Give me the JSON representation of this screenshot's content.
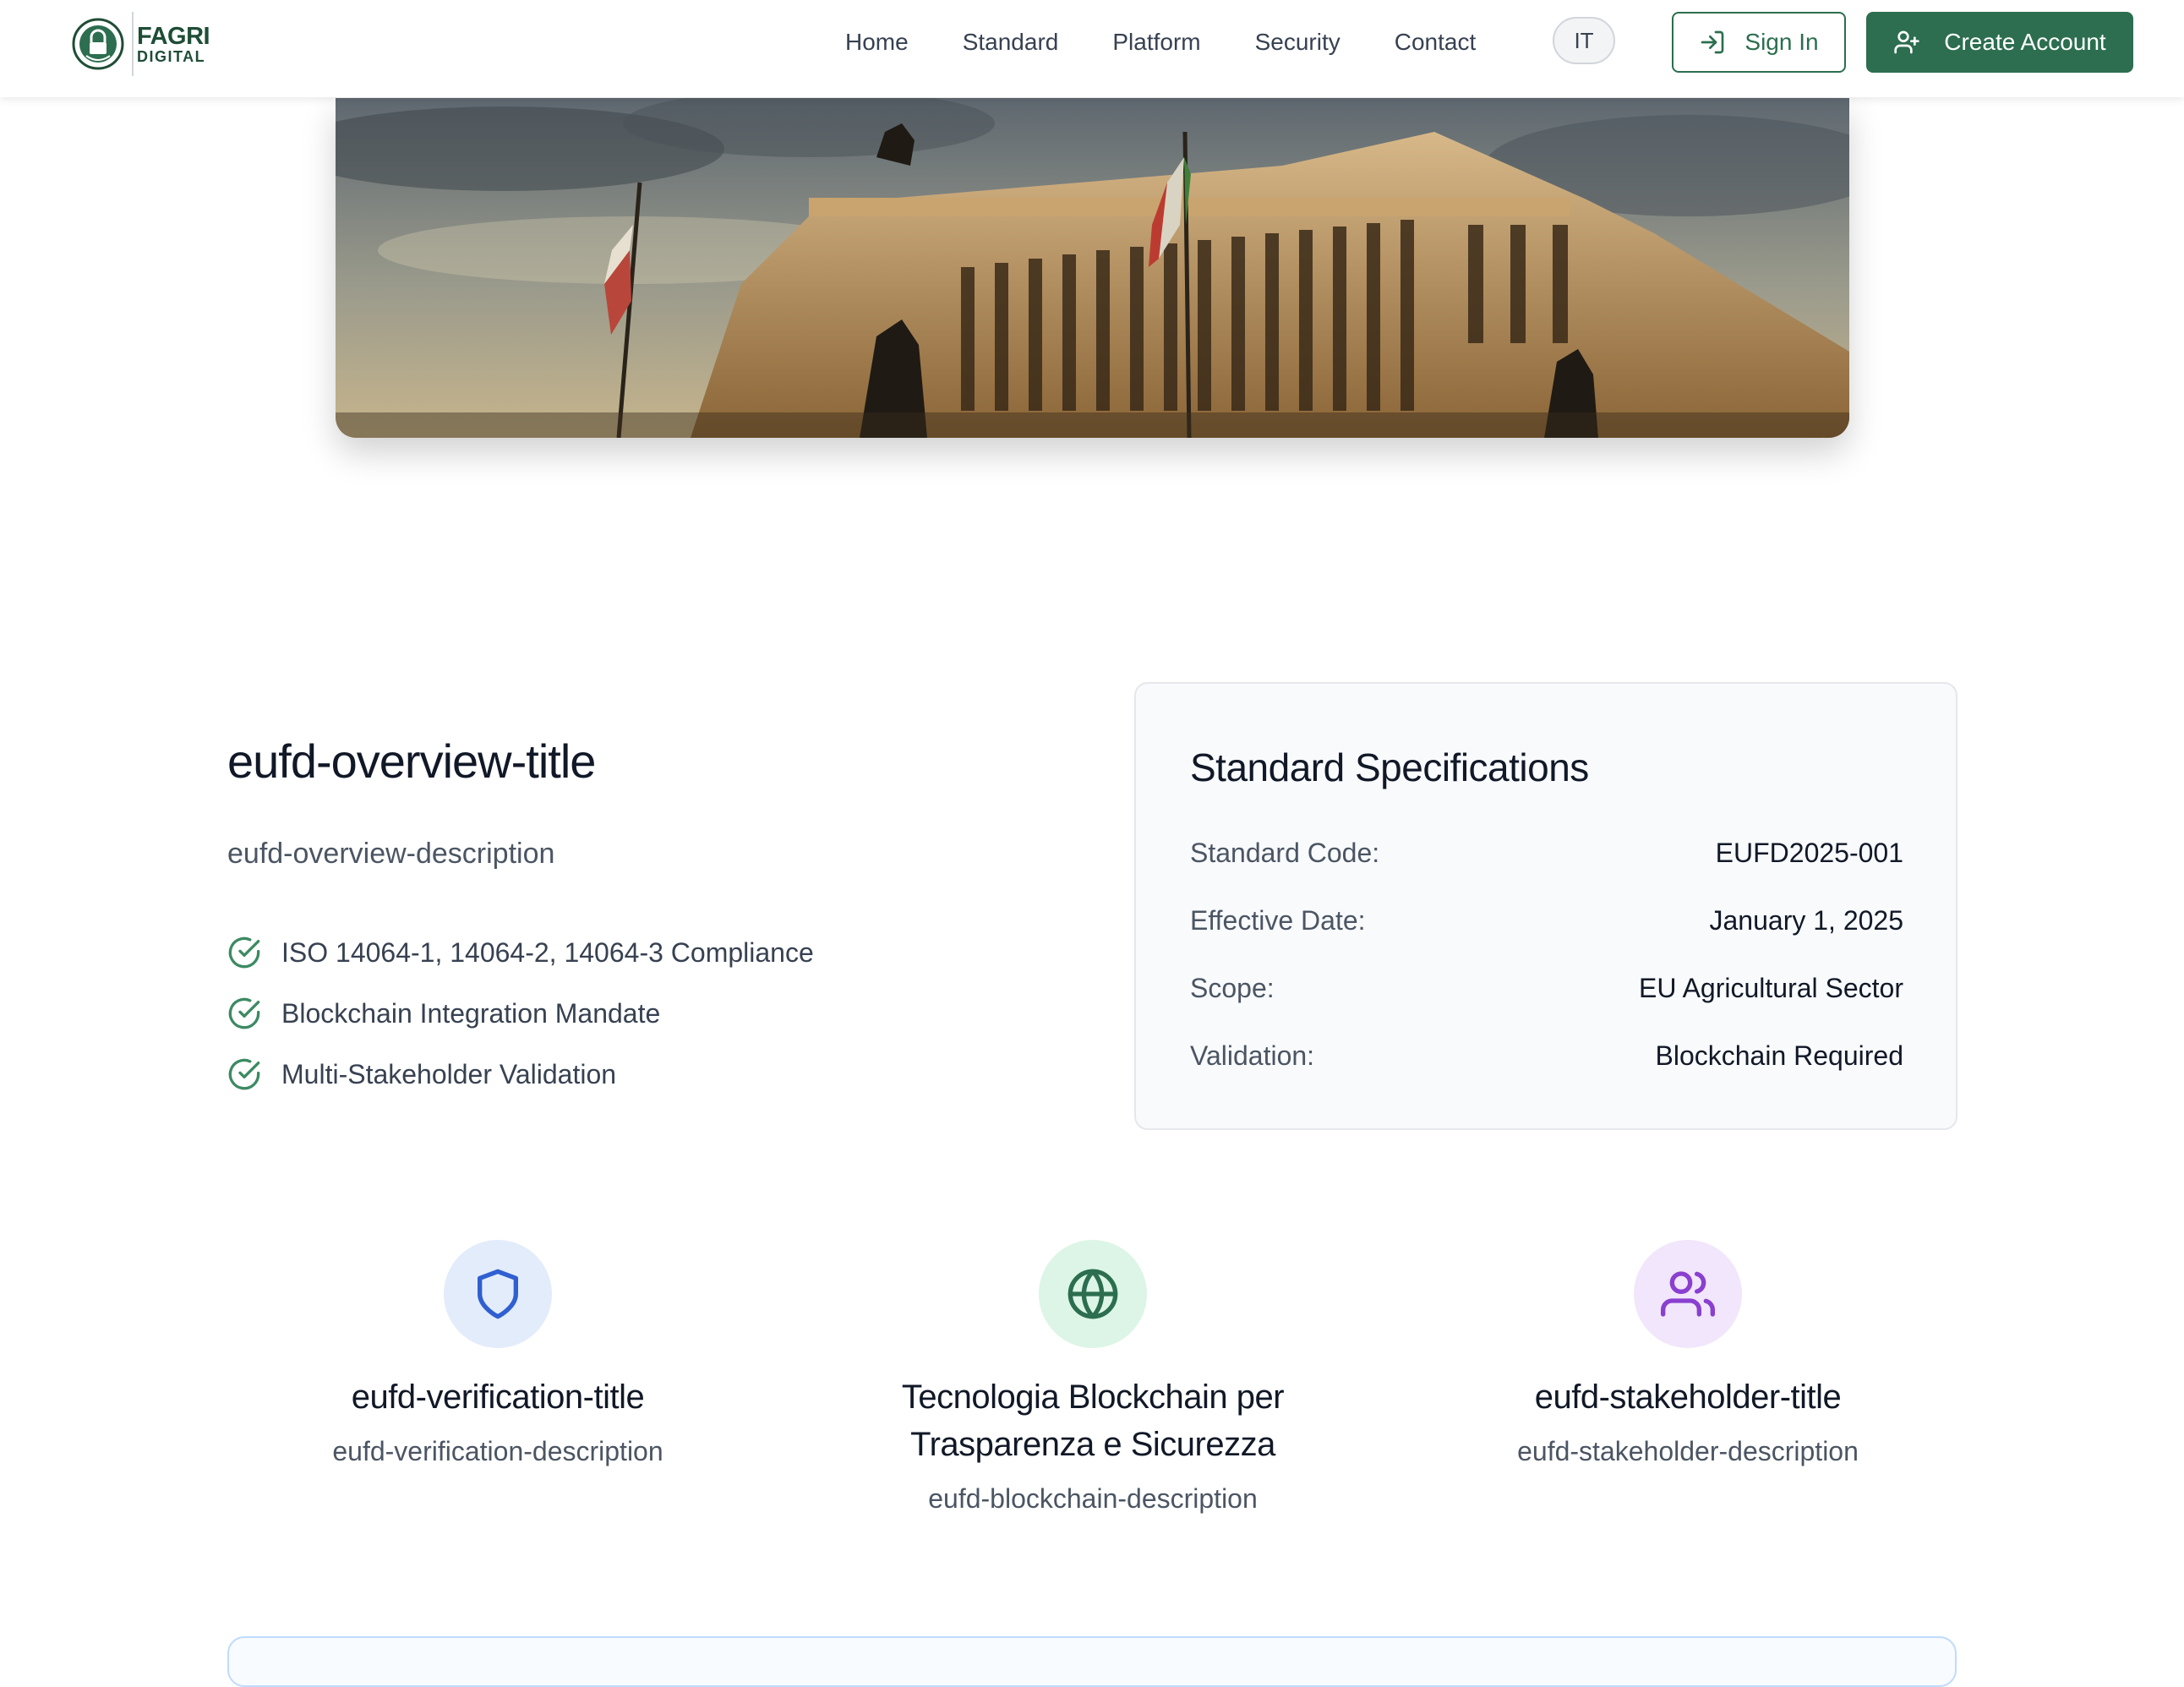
{
  "header": {
    "logo": {
      "line1": "FAGRI",
      "line2": "DIGITAL"
    },
    "nav": [
      "Home",
      "Standard",
      "Platform",
      "Security",
      "Contact"
    ],
    "language": "IT",
    "sign_in_label": "Sign In",
    "create_account_label": "Create Account"
  },
  "overview": {
    "title": "eufd-overview-title",
    "description": "eufd-overview-description",
    "items": [
      "ISO 14064-1, 14064-2, 14064-3 Compliance",
      "Blockchain Integration Mandate",
      "Multi-Stakeholder Validation"
    ]
  },
  "specs": {
    "title": "Standard Specifications",
    "rows": [
      {
        "label": "Standard Code:",
        "value": "EUFD2025-001"
      },
      {
        "label": "Effective Date:",
        "value": "January 1, 2025"
      },
      {
        "label": "Scope:",
        "value": "EU Agricultural Sector"
      },
      {
        "label": "Validation:",
        "value": "Blockchain Required"
      }
    ]
  },
  "features": [
    {
      "icon": "shield-icon",
      "title": "eufd-verification-title",
      "description": "eufd-verification-description",
      "icon_color": "#2f5fd0",
      "bg_color": "#e3ecfb"
    },
    {
      "icon": "globe-icon",
      "title": "Tecnologia Blockchain per Trasparenza e Sicurezza",
      "description": "eufd-blockchain-description",
      "icon_color": "#2c6e4f",
      "bg_color": "#dcf5e6"
    },
    {
      "icon": "users-icon",
      "title": "eufd-stakeholder-title",
      "description": "eufd-stakeholder-description",
      "icon_color": "#8a3fd0",
      "bg_color": "#f1e6fb"
    }
  ],
  "colors": {
    "brand": "#2c6e4f",
    "check": "#3d8a63"
  }
}
